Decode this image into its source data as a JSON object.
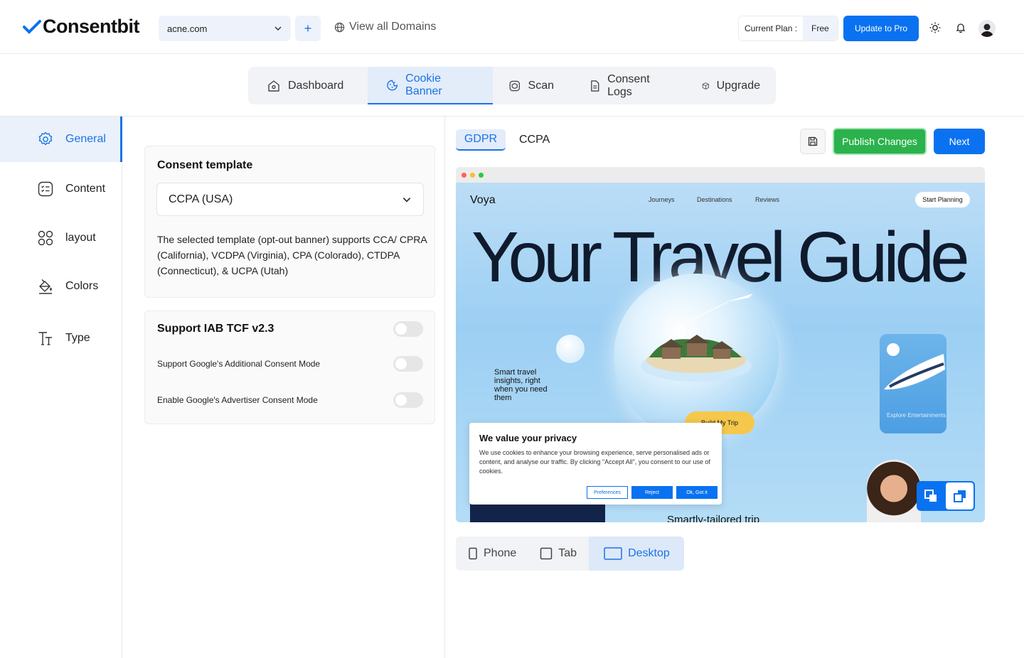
{
  "app": {
    "logo_text": "Consentbit",
    "brand_color": "#0a72f0",
    "success_color": "#2bb24c"
  },
  "header": {
    "domain": "acne.com",
    "add_label": "+",
    "view_all": "View all Domains",
    "plan_label": "Current Plan :",
    "plan_value": "Free",
    "update_label": "Update to Pro"
  },
  "nav": {
    "tabs": [
      {
        "label": "Dashboard",
        "icon": "home-icon"
      },
      {
        "label": "Cookie Banner",
        "icon": "cookie-icon",
        "active": true
      },
      {
        "label": "Scan",
        "icon": "scan-icon"
      },
      {
        "label": "Consent Logs",
        "icon": "document-icon"
      },
      {
        "label": "Upgrade",
        "icon": "box-icon"
      }
    ]
  },
  "sidebar": {
    "items": [
      {
        "label": "General",
        "icon": "gear-icon",
        "active": true
      },
      {
        "label": "Content",
        "icon": "list-icon"
      },
      {
        "label": "layout",
        "icon": "grid-icon"
      },
      {
        "label": "Colors",
        "icon": "paint-bucket-icon"
      },
      {
        "label": "Type",
        "icon": "text-icon"
      }
    ]
  },
  "consent_template": {
    "title": "Consent template",
    "selected": "CCPA (USA)",
    "description": "The selected template (opt-out banner) supports CCA/ CPRA (California), VCDPA (Virginia), CPA (Colorado), CTDPA (Connecticut), & UCPA (Utah)"
  },
  "iab": {
    "title": "Support IAB TCF v2.3",
    "options": [
      {
        "label": "Support Google's Additional Consent Mode",
        "on": false
      },
      {
        "label": "Enable Google's Advertiser Consent Mode",
        "on": false
      }
    ]
  },
  "preview": {
    "tabs": [
      "GDPR",
      "CCPA"
    ],
    "publish_label": "Publish Changes",
    "next_label": "Next",
    "site": {
      "logo": "Voya",
      "nav": [
        "Journeys",
        "Destinations",
        "Reviews"
      ],
      "cta": "Start Planning",
      "hero": "Your Travel Guide",
      "smart": "Smart travel insights, right when you need them",
      "trip_btn": "Build My Trip",
      "ent": "Explore Entertainments",
      "smartly": "Smartly-tailored trip"
    },
    "banner": {
      "title": "We value your privacy",
      "text": "We use cookies to enhance your browsing experience, serve personalised ads or content, and analyse our traffic. By clicking \"Accept All\", you consent to our use of cookies.",
      "preferences": "Preferences",
      "reject": "Reject",
      "accept": "Ok, Got it"
    }
  },
  "devices": [
    {
      "label": "Phone"
    },
    {
      "label": "Tab"
    },
    {
      "label": "Desktop",
      "active": true
    }
  ]
}
